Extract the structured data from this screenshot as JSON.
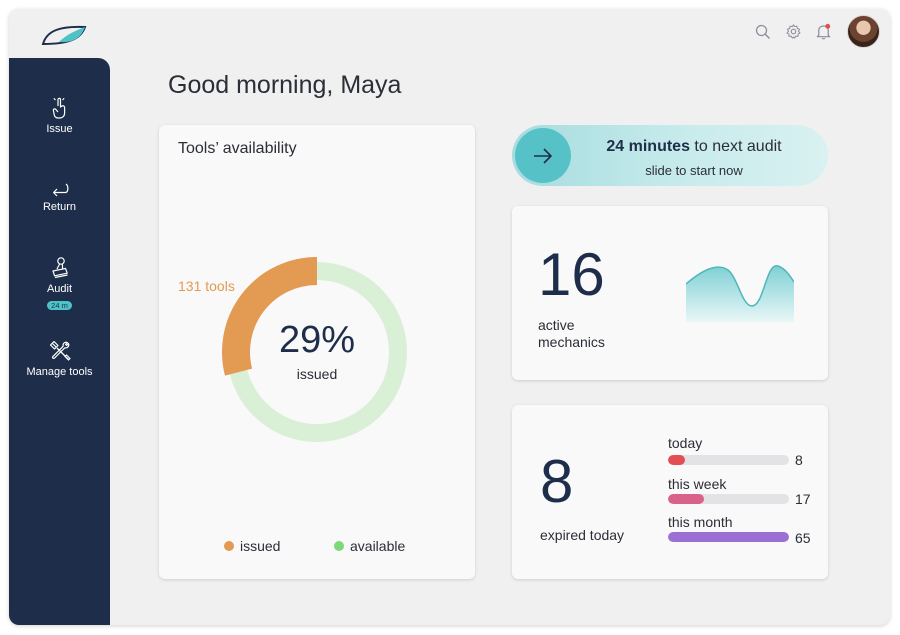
{
  "header": {
    "logo": "leaf-logo",
    "icons": [
      "search-icon",
      "gear-icon",
      "bell-icon"
    ],
    "has_notification": true
  },
  "sidebar": {
    "items": [
      {
        "label": "Issue",
        "icon": "hand-pointer-icon"
      },
      {
        "label": "Return",
        "icon": "return-arrow-icon"
      },
      {
        "label": "Audit",
        "icon": "stamp-icon",
        "badge": "24 m"
      },
      {
        "label": "Manage tools",
        "icon": "tools-icon"
      }
    ]
  },
  "greeting": "Good morning, Maya",
  "availability": {
    "title": "Tools’ availability",
    "tools_count_label": "131 tools",
    "percent_label": "29%",
    "percent_sub": "issued",
    "issued_fraction": 0.29,
    "legend": [
      {
        "label": "issued",
        "color": "#e39a52"
      },
      {
        "label": "available",
        "color": "#7dd87a"
      }
    ],
    "colors": {
      "issued": "#e39a52",
      "available": "#d9efd6"
    }
  },
  "audit": {
    "bold": "24 minutes",
    "rest": " to next audit",
    "sub": "slide to start now",
    "color": "#56c2c7"
  },
  "mechanics": {
    "count": "16",
    "label_line1": "active",
    "label_line2": "mechanics"
  },
  "expired": {
    "count": "8",
    "label": "expired today",
    "rows": [
      {
        "label": "today",
        "value": "8",
        "fraction": 0.14,
        "color": "#e34d53"
      },
      {
        "label": "this week",
        "value": "17",
        "fraction": 0.3,
        "color": "#d9628a"
      },
      {
        "label": "this month",
        "value": "65",
        "fraction": 1.0,
        "color": "#9b6fd3"
      }
    ]
  }
}
